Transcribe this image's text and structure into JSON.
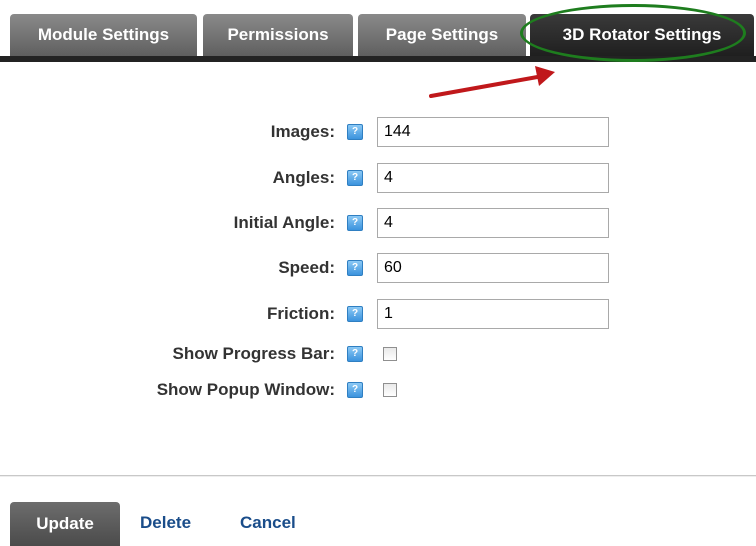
{
  "tabs": [
    {
      "label": "Module Settings",
      "active": false
    },
    {
      "label": "Permissions",
      "active": false
    },
    {
      "label": "Page Settings",
      "active": false
    },
    {
      "label": "3D Rotator Settings",
      "active": true
    }
  ],
  "annotation": {
    "ring_color": "#1e7d1e",
    "arrow_color": "#c0181b"
  },
  "help_icon_label": "?",
  "form": {
    "fields": [
      {
        "label": "Images:",
        "value": "144"
      },
      {
        "label": "Angles:",
        "value": "4"
      },
      {
        "label": "Initial Angle:",
        "value": "4"
      },
      {
        "label": "Speed:",
        "value": "60"
      },
      {
        "label": "Friction:",
        "value": "1"
      }
    ],
    "checkboxes": [
      {
        "label": "Show Progress Bar:",
        "checked": false
      },
      {
        "label": "Show Popup Window:",
        "checked": false
      }
    ]
  },
  "actions": {
    "update": "Update",
    "delete": "Delete",
    "cancel": "Cancel"
  }
}
